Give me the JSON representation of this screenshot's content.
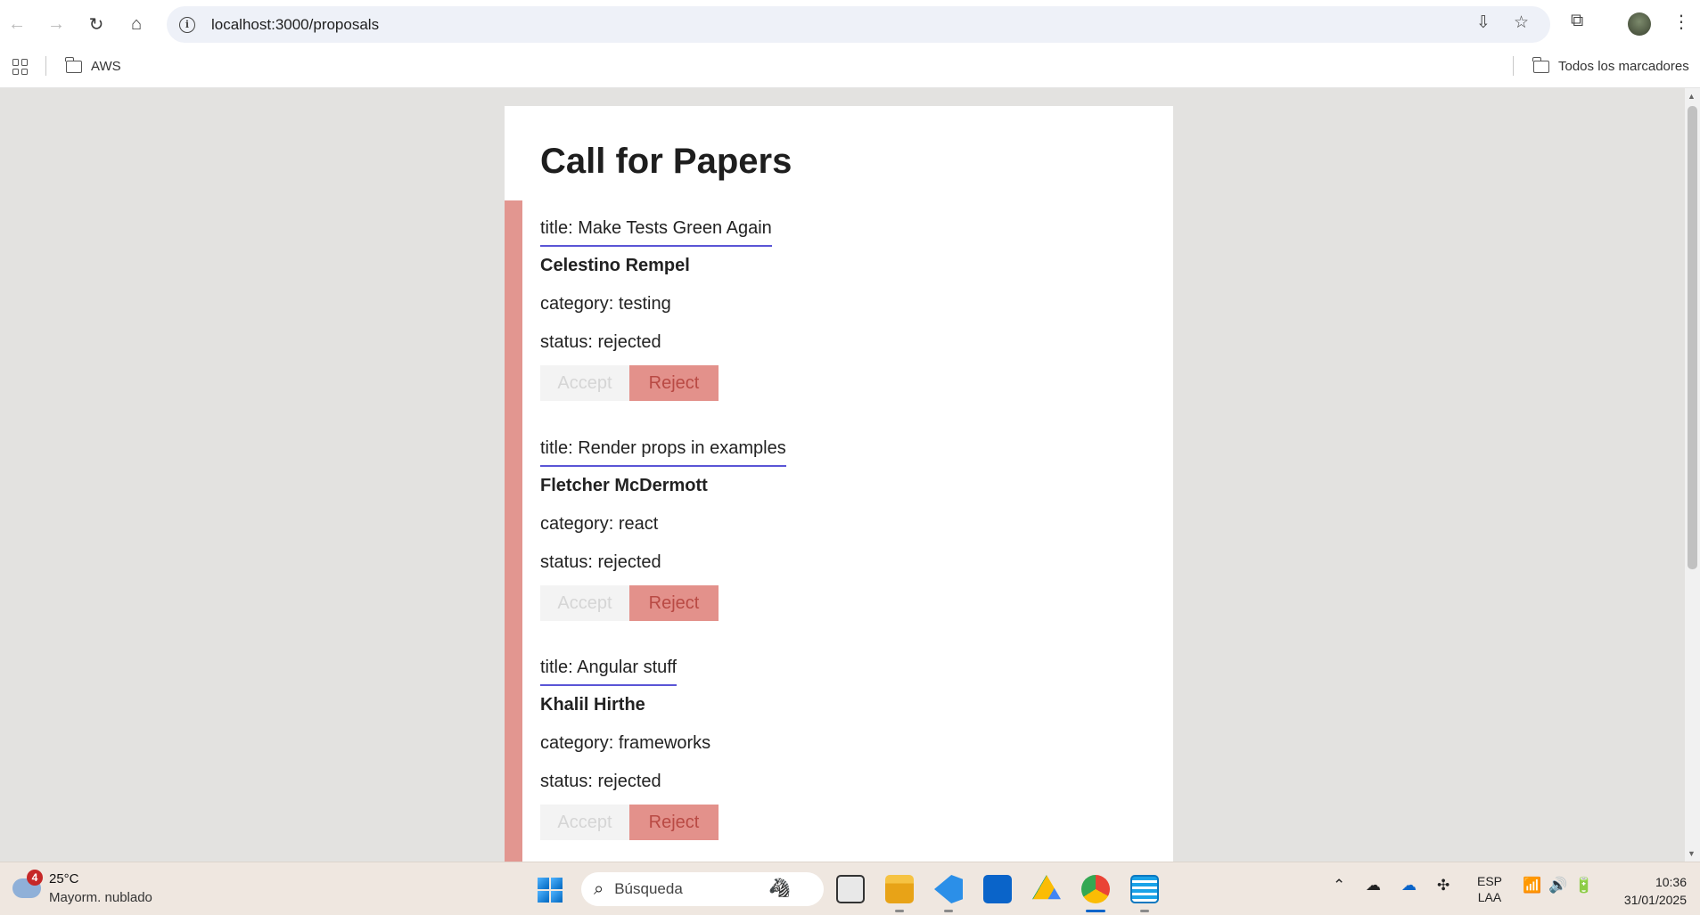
{
  "browser": {
    "url": "localhost:3000/proposals",
    "bookmarks": [
      "AWS"
    ],
    "all_bookmarks_label": "Todos los marcadores"
  },
  "page": {
    "title": "Call for Papers",
    "proposals": [
      {
        "title": "title: Make Tests Green Again",
        "speaker": "Celestino Rempel",
        "category": "category: testing",
        "status": "status: rejected",
        "accept_label": "Accept",
        "reject_label": "Reject"
      },
      {
        "title": "title: Render props in examples",
        "speaker": "Fletcher McDermott",
        "category": "category: react",
        "status": "status: rejected",
        "accept_label": "Accept",
        "reject_label": "Reject"
      },
      {
        "title": "title: Angular stuff",
        "speaker": "Khalil Hirthe",
        "category": "category: frameworks",
        "status": "status: rejected",
        "accept_label": "Accept",
        "reject_label": "Reject"
      }
    ]
  },
  "taskbar": {
    "weather_badge": "4",
    "weather_temp": "25°C",
    "weather_desc": "Mayorm. nublado",
    "search_placeholder": "Búsqueda",
    "lang_primary": "ESP",
    "lang_secondary": "LAA",
    "time": "10:36",
    "date": "31/01/2025"
  },
  "colors": {
    "accent_bar": "#e29690",
    "title_underline": "#5a55d6",
    "reject_bg": "#e3918b",
    "reject_text": "#b94a44",
    "accept_bg": "#f3f3f3",
    "accept_text": "#d5d5d5"
  },
  "icons": [
    "back-arrow-icon",
    "forward-arrow-icon",
    "reload-icon",
    "home-icon",
    "site-info-icon",
    "install-app-icon",
    "bookmark-star-icon",
    "extensions-icon",
    "menu-kebab-icon",
    "apps-grid-icon",
    "folder-icon",
    "windows-start-icon",
    "search-icon"
  ]
}
